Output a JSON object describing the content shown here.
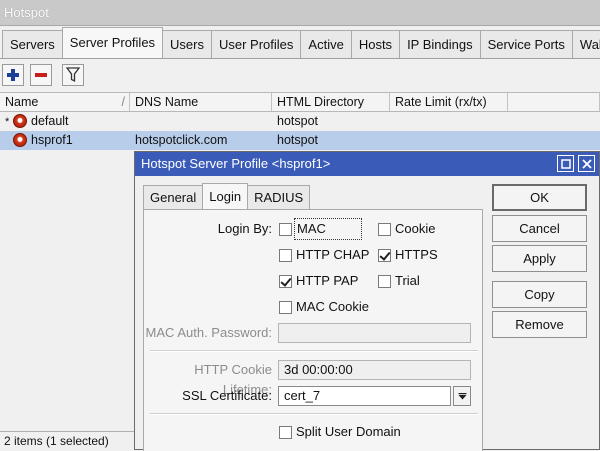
{
  "window": {
    "title": "Hotspot"
  },
  "tabs": [
    "Servers",
    "Server Profiles",
    "Users",
    "User Profiles",
    "Active",
    "Hosts",
    "IP Bindings",
    "Service Ports",
    "Walled"
  ],
  "table": {
    "columns": [
      "Name",
      "DNS Name",
      "HTML Directory",
      "Rate Limit (rx/tx)"
    ],
    "rows": [
      {
        "marker": "*",
        "name": "default",
        "dns": "",
        "html_dir": "hotspot",
        "rate": ""
      },
      {
        "marker": "",
        "name": "hsprof1",
        "dns": "hotspotclick.com",
        "html_dir": "hotspot",
        "rate": ""
      }
    ]
  },
  "status": "2 items (1 selected)",
  "dialog": {
    "title": "Hotspot Server Profile <hsprof1>",
    "tabs": [
      "General",
      "Login",
      "RADIUS"
    ],
    "login_by_label": "Login By:",
    "options": {
      "mac": "MAC",
      "cookie": "Cookie",
      "http_chap": "HTTP CHAP",
      "https": "HTTPS",
      "http_pap": "HTTP PAP",
      "trial": "Trial",
      "mac_cookie": "MAC Cookie"
    },
    "mac_auth_password_label": "MAC Auth. Password:",
    "mac_auth_password_value": "",
    "cookie_lifetime_label": "HTTP Cookie Lifetime:",
    "cookie_lifetime_value": "3d 00:00:00",
    "ssl_certificate_label": "SSL Certificate:",
    "ssl_certificate_value": "cert_7",
    "split_user_domain": "Split User Domain",
    "buttons": {
      "ok": "OK",
      "cancel": "Cancel",
      "apply": "Apply",
      "copy": "Copy",
      "remove": "Remove"
    }
  }
}
